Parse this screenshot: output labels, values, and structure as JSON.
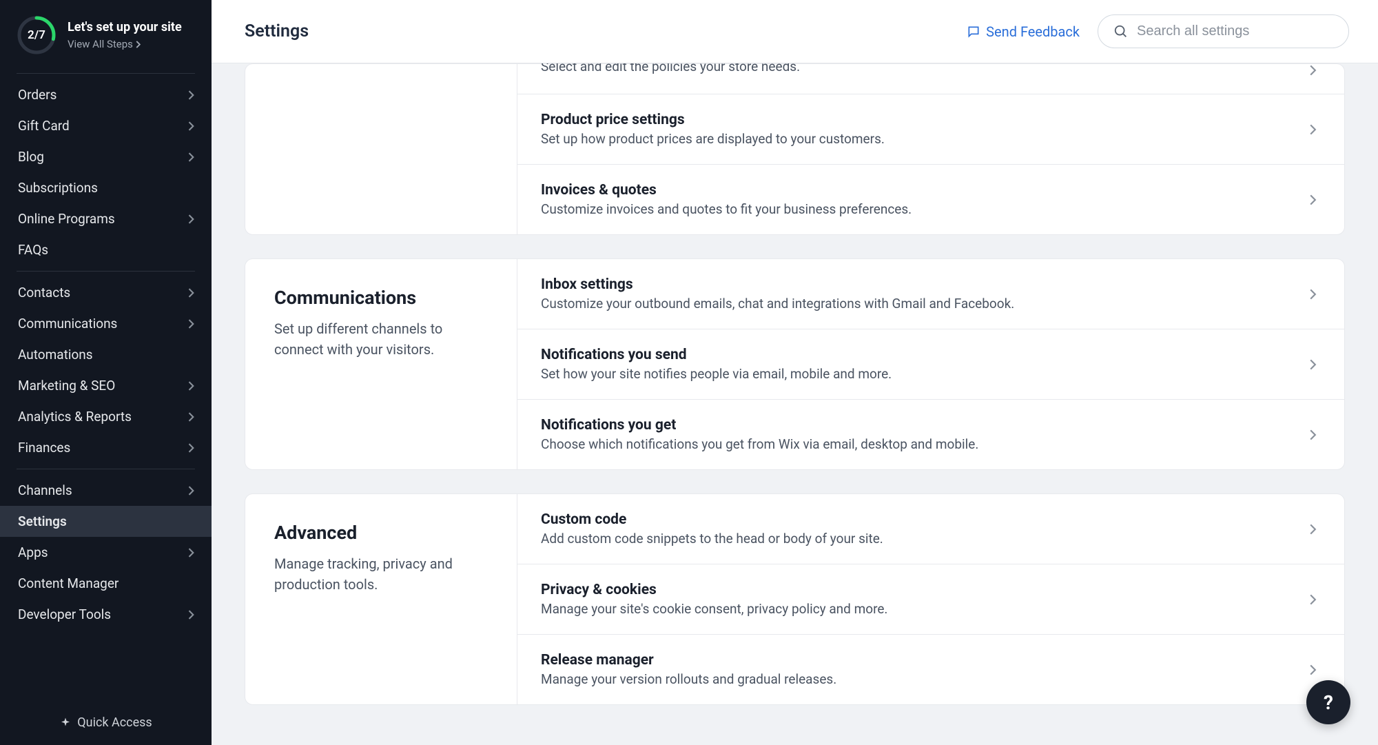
{
  "setup": {
    "progress": "2/7",
    "title": "Let's set up your site",
    "view_link": "View All Steps"
  },
  "nav": {
    "group1": [
      {
        "label": "Orders",
        "chev": true
      },
      {
        "label": "Gift Card",
        "chev": true
      },
      {
        "label": "Blog",
        "chev": true
      },
      {
        "label": "Subscriptions",
        "chev": false
      },
      {
        "label": "Online Programs",
        "chev": true
      },
      {
        "label": "FAQs",
        "chev": false
      }
    ],
    "group2": [
      {
        "label": "Contacts",
        "chev": true
      },
      {
        "label": "Communications",
        "chev": true
      },
      {
        "label": "Automations",
        "chev": false
      },
      {
        "label": "Marketing & SEO",
        "chev": true
      },
      {
        "label": "Analytics & Reports",
        "chev": true
      },
      {
        "label": "Finances",
        "chev": true
      }
    ],
    "group3": [
      {
        "label": "Channels",
        "chev": true
      },
      {
        "label": "Settings",
        "chev": false,
        "active": true
      },
      {
        "label": "Apps",
        "chev": true
      },
      {
        "label": "Content Manager",
        "chev": false
      },
      {
        "label": "Developer Tools",
        "chev": true
      }
    ]
  },
  "quick_access": "Quick Access",
  "topbar": {
    "title": "Settings",
    "feedback": "Send Feedback",
    "search_placeholder": "Search all settings"
  },
  "sections": [
    {
      "heading": "",
      "desc": "",
      "rows": [
        {
          "title": "",
          "desc": "Select and edit the policies your store needs."
        },
        {
          "title": "Product price settings",
          "desc": "Set up how product prices are displayed to your customers."
        },
        {
          "title": "Invoices & quotes",
          "desc": "Customize invoices and quotes to fit your business preferences."
        }
      ]
    },
    {
      "heading": "Communications",
      "desc": "Set up different channels to connect with your visitors.",
      "rows": [
        {
          "title": "Inbox settings",
          "desc": "Customize your outbound emails, chat and integrations with Gmail and Facebook."
        },
        {
          "title": "Notifications you send",
          "desc": "Set how your site notifies people via email, mobile and more."
        },
        {
          "title": "Notifications you get",
          "desc": "Choose which notifications you get from Wix via email, desktop and mobile."
        }
      ]
    },
    {
      "heading": "Advanced",
      "desc": "Manage tracking, privacy and production tools.",
      "rows": [
        {
          "title": "Custom code",
          "desc": "Add custom code snippets to the head or body of your site."
        },
        {
          "title": "Privacy & cookies",
          "desc": "Manage your site's cookie consent, privacy policy and more."
        },
        {
          "title": "Release manager",
          "desc": "Manage your version rollouts and gradual releases."
        }
      ]
    }
  ],
  "help": "?"
}
